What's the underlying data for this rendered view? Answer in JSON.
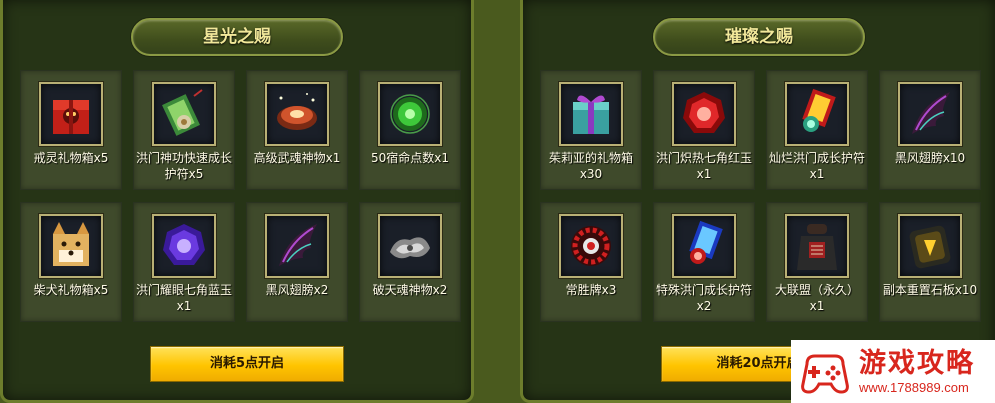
{
  "left_panel": {
    "title": "星光之赐",
    "items": [
      {
        "label": "戒灵礼物箱x5",
        "icon": "red-gift-box-icon"
      },
      {
        "label": "洪门神功快速成长护符x5",
        "icon": "green-talisman-icon"
      },
      {
        "label": "高级武魂神物x1",
        "icon": "red-spirit-orb-icon"
      },
      {
        "label": "50宿命点数x1",
        "icon": "green-jade-icon"
      },
      {
        "label": "柴犬礼物箱x5",
        "icon": "shiba-gift-box-icon"
      },
      {
        "label": "洪门耀眼七角蓝玉x1",
        "icon": "blue-heptagon-gem-icon"
      },
      {
        "label": "黑风翅膀x2",
        "icon": "black-wing-icon"
      },
      {
        "label": "破天魂神物x2",
        "icon": "grey-spirit-relic-icon"
      }
    ],
    "button_label": "消耗5点开启"
  },
  "right_panel": {
    "title": "璀璨之赐",
    "items": [
      {
        "label": "茱莉亚的礼物箱x30",
        "icon": "julia-gift-box-icon"
      },
      {
        "label": "洪门炽热七角红玉x1",
        "icon": "red-heptagon-gem-icon"
      },
      {
        "label": "灿烂洪门成长护符x1",
        "icon": "red-talisman-icon"
      },
      {
        "label": "黑风翅膀x10",
        "icon": "black-wing-icon"
      },
      {
        "label": "常胜牌x3",
        "icon": "victory-token-icon"
      },
      {
        "label": "特殊洪门成长护符x2",
        "icon": "blue-talisman-icon"
      },
      {
        "label": "大联盟（永久）x1",
        "icon": "alliance-costume-icon"
      },
      {
        "label": "副本重置石板x10",
        "icon": "reset-stone-tablet-icon"
      }
    ],
    "button_label": "消耗20点开启"
  },
  "watermark": {
    "title": "游戏攻略",
    "url": "www.1788989.com"
  },
  "colors": {
    "panel_bg": "#263416",
    "panel_border": "#6d7d2c",
    "title_text": "#f2e89a",
    "button": "#ffc400",
    "watermark_red": "#d8261d"
  }
}
